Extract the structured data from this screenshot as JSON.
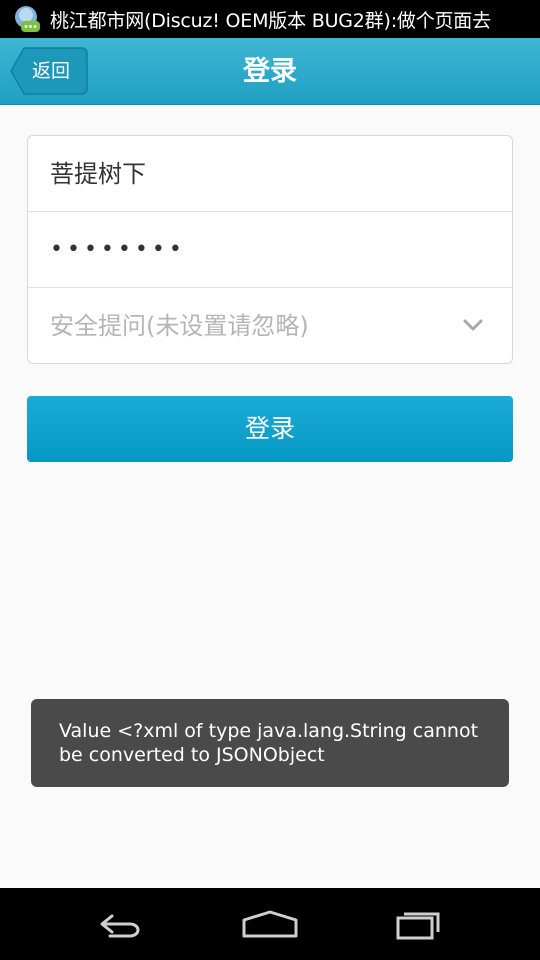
{
  "status_bar": {
    "notification_text": "桃江都市网(Discuz! OEM版本 BUG2群):做个页面去"
  },
  "title_bar": {
    "back_label": "返回",
    "title": "登录"
  },
  "form": {
    "username_value": "菩提树下",
    "password_masked": "••••••••",
    "security_question_placeholder": "安全提问(未设置请忽略)"
  },
  "login_button_label": "登录",
  "toast_message": "Value <?xml of type java.lang.String cannot be converted to JSONObject",
  "colors": {
    "title_bar": "#22a3c5",
    "login_button": "#0aa0cc",
    "toast_background": "#4a4a4a"
  },
  "icons": {
    "status": "message-app-icon",
    "dropdown": "chevron-down-icon",
    "nav_back": "nav-back-icon",
    "nav_home": "nav-home-icon",
    "nav_recent": "nav-recent-apps-icon"
  }
}
